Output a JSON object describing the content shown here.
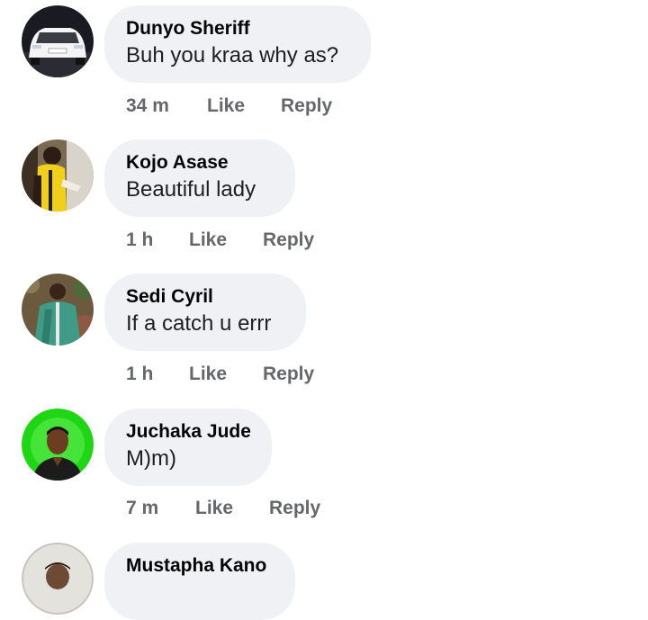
{
  "comments": [
    {
      "author": "Dunyo Sheriff",
      "text": "Buh you kraa why as?",
      "time": "34 m",
      "like": "Like",
      "reply": "Reply"
    },
    {
      "author": "Kojo Asase",
      "text": "Beautiful lady",
      "time": "1 h",
      "like": "Like",
      "reply": "Reply"
    },
    {
      "author": "Sedi Cyril",
      "text": "If a catch u errr",
      "time": "1 h",
      "like": "Like",
      "reply": "Reply"
    },
    {
      "author": "Juchaka Jude",
      "text": "M)m)",
      "time": "7 m",
      "like": "Like",
      "reply": "Reply"
    },
    {
      "author": "Mustapha Kano",
      "text": "",
      "time": "",
      "like": "",
      "reply": ""
    }
  ],
  "colors": {
    "bubble_bg": "#eff1f4",
    "meta_text": "#65676b",
    "author_text": "#050505"
  },
  "icons": [
    "avatar-car",
    "avatar-person-yellow",
    "avatar-person-green",
    "avatar-person-greenscreen",
    "avatar-person-light"
  ]
}
